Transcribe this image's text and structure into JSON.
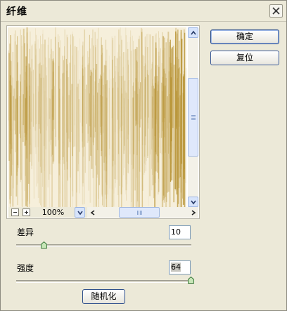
{
  "window": {
    "title": "纤维"
  },
  "preview": {
    "zoom": "100%"
  },
  "buttons": {
    "ok": "确定",
    "reset": "复位",
    "randomize": "随机化"
  },
  "variance": {
    "label": "差异",
    "value": "10",
    "level": 10,
    "max": 64
  },
  "strength": {
    "label": "强度",
    "value": "64",
    "level": 64,
    "max": 64
  },
  "colors": {
    "fiber_light": "#f6efdb",
    "fiber_dark": "#b99538"
  }
}
